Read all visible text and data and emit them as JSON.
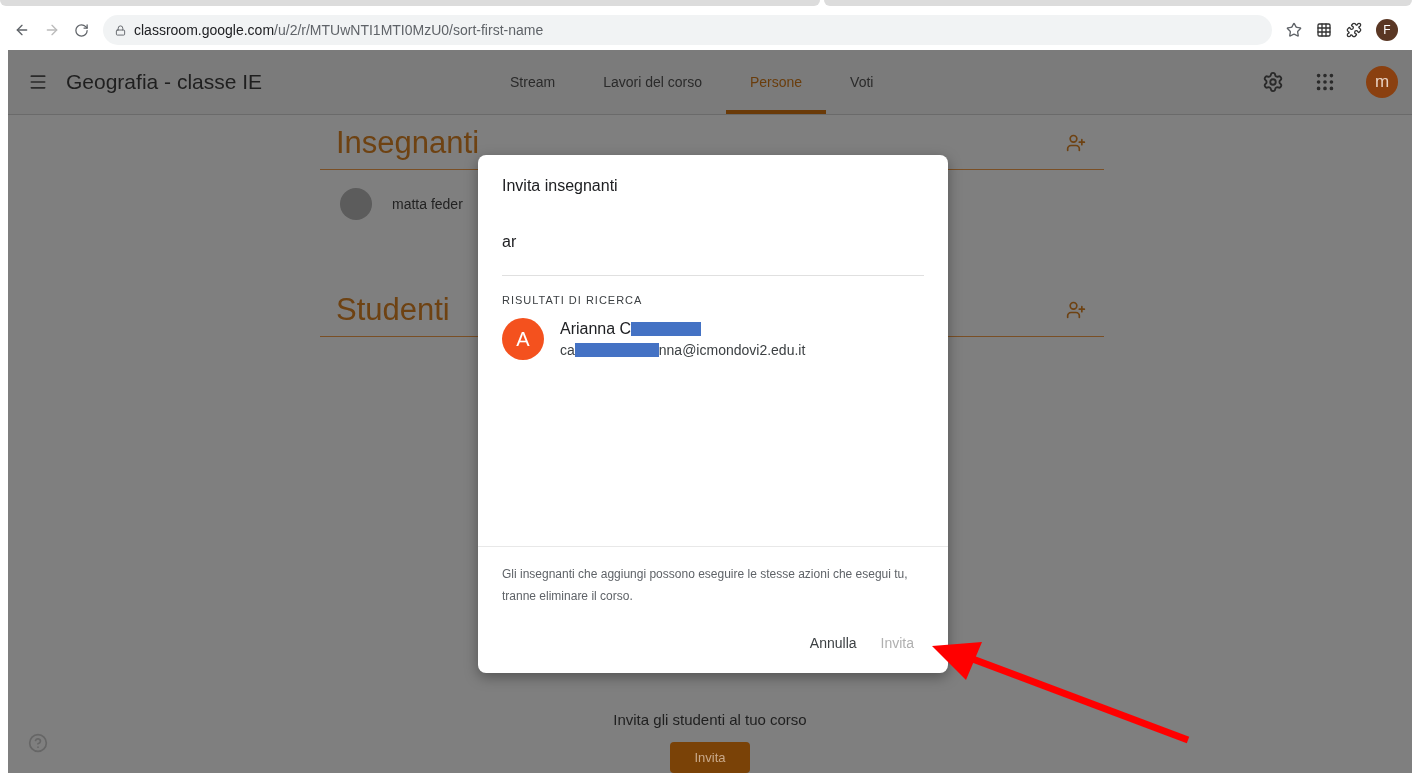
{
  "browser": {
    "url_host": "classroom.google.com",
    "url_path": "/u/2/r/MTUwNTI1MTI0MzU0/sort-first-name",
    "profile_initial": "F"
  },
  "header": {
    "title": "Geografia - classe IE",
    "account_initial": "m"
  },
  "tabs": [
    {
      "label": "Stream",
      "selected": false
    },
    {
      "label": "Lavori del corso",
      "selected": false
    },
    {
      "label": "Persone",
      "selected": true
    },
    {
      "label": "Voti",
      "selected": false
    }
  ],
  "sections": [
    {
      "title": "Insegnanti",
      "people": [
        {
          "name": "matta feder"
        }
      ]
    },
    {
      "title": "Studenti"
    }
  ],
  "invite_students": {
    "text": "Invita gli studenti al tuo corso",
    "button": "Invita"
  },
  "dialog": {
    "title": "Invita insegnanti",
    "search_value": "ar",
    "results_heading": "RISULTATI DI RICERCA",
    "results": [
      {
        "initial": "A",
        "color": "#f4511e",
        "name": "Arianna C",
        "email_start": "ca",
        "email_end": "nna@icmondovi2.edu.it"
      }
    ],
    "note": "Gli insegnanti che aggiungi possono eseguire le stesse azioni che esegui tu, tranne eliminare il corso.",
    "buttons": [
      {
        "label": "Annulla",
        "disabled": false
      },
      {
        "label": "Invita",
        "disabled": true
      }
    ]
  }
}
